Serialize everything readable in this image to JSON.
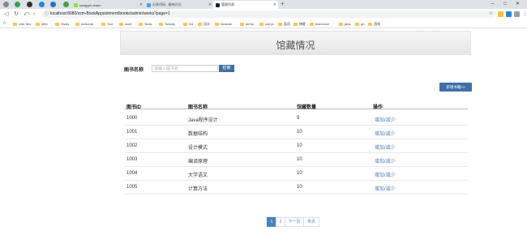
{
  "browser": {
    "tabs": [
      {
        "label": "swagger-realm"
      },
      {
        "label": "分享代码 - 接待方式"
      },
      {
        "label": "管理列表"
      }
    ],
    "url": "localhost:8080/ssm-BookAppointment/books/admin/works?page=1",
    "new_tab": "+",
    "win_controls": [
      "–",
      "□",
      "✕"
    ]
  },
  "bookmarks": [
    {
      "label": "Like Sex"
    },
    {
      "label": "offer"
    },
    {
      "label": "Study"
    },
    {
      "label": "mzsunte"
    },
    {
      "label": "Tool"
    },
    {
      "label": "work"
    },
    {
      "label": "Tools"
    },
    {
      "label": "Todody"
    },
    {
      "label": "G4"
    },
    {
      "label": "设计"
    },
    {
      "label": "haowan"
    },
    {
      "label": "demo"
    },
    {
      "label": "vue.js"
    },
    {
      "label": "面试"
    },
    {
      "label": "博客"
    },
    {
      "label": "team-tool"
    },
    {
      "label": "java"
    },
    {
      "label": "go"
    },
    {
      "label": "游戏"
    }
  ],
  "page": {
    "title": "馆藏情况",
    "search": {
      "label": "图书名称",
      "placeholder": "请输入图书名",
      "button": "检索"
    },
    "add_button": "新增书籍>>",
    "table": {
      "headers": [
        "图书ID",
        "图书名称",
        "馆藏数量",
        "操作"
      ],
      "rows": [
        {
          "id": "1000",
          "name": "Java程序设计",
          "qty": "9",
          "action": "增加/减少"
        },
        {
          "id": "1001",
          "name": "数据结构",
          "qty": "10",
          "action": "增加/减少"
        },
        {
          "id": "1002",
          "name": "设计模式",
          "qty": "10",
          "action": "增加/减少"
        },
        {
          "id": "1003",
          "name": "编译原理",
          "qty": "10",
          "action": "增加/减少"
        },
        {
          "id": "1004",
          "name": "大学语文",
          "qty": "10",
          "action": "增加/减少"
        },
        {
          "id": "1005",
          "name": "计算方法",
          "qty": "10",
          "action": "增加/减少"
        }
      ]
    },
    "pager": [
      "1",
      "2",
      "下一页",
      "末页"
    ]
  },
  "colors": {
    "primary_button": "#3f6fa8",
    "link": "#4a7fb8",
    "pager_active": "#3f84c6"
  }
}
